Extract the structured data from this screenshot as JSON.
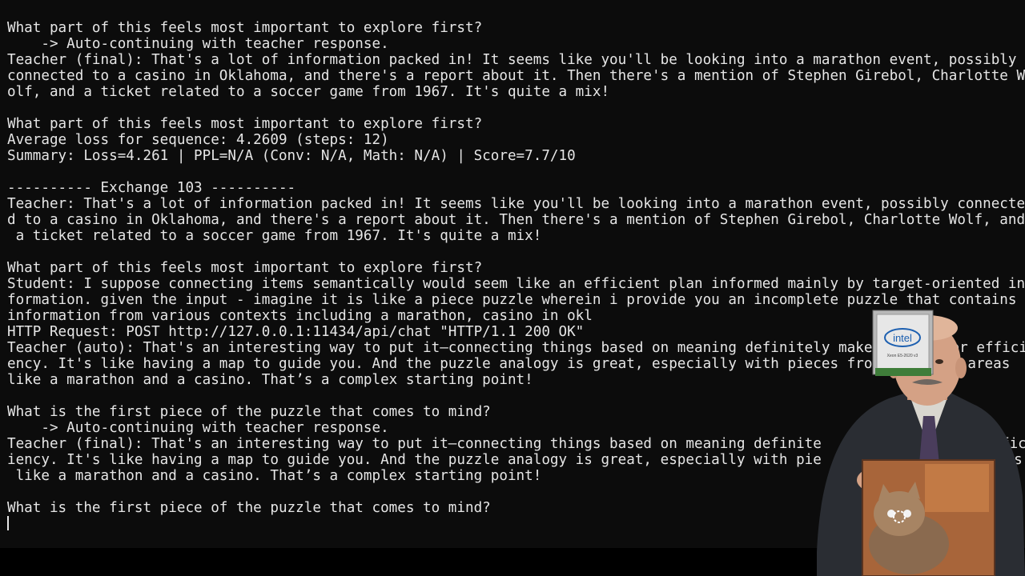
{
  "terminal": {
    "lines": [
      "What part of this feels most important to explore first?",
      "    -> Auto-continuing with teacher response.",
      "Teacher (final): That's a lot of information packed in! It seems like you'll be looking into a marathon event, possibly",
      "connected to a casino in Oklahoma, and there's a report about it. Then there's a mention of Stephen Girebol, Charlotte W",
      "olf, and a ticket related to a soccer game from 1967. It's quite a mix!",
      "",
      "What part of this feels most important to explore first?",
      "Average loss for sequence: 4.2609 (steps: 12)",
      "Summary: Loss=4.261 | PPL=N/A (Conv: N/A, Math: N/A) | Score=7.7/10",
      "",
      "---------- Exchange 103 ----------",
      "Teacher: That's a lot of information packed in! It seems like you'll be looking into a marathon event, possibly connecte",
      "d to a casino in Oklahoma, and there's a report about it. Then there's a mention of Stephen Girebol, Charlotte Wolf, and",
      " a ticket related to a soccer game from 1967. It's quite a mix!",
      "",
      "What part of this feels most important to explore first?",
      "Student: I suppose connecting items semantically would seem like an efficient plan informed mainly by target-oriented in",
      "formation. given the input - imagine it is like a piece puzzle wherein i provide you an incomplete puzzle that contains",
      "information from various contexts including a marathon, casino in okl",
      "HTTP Request: POST http://127.0.0.1:11434/api/chat \"HTTP/1.1 200 OK\"",
      "Teacher (auto): That's an interesting way to put it—connecting things based on meaning definitely make",
      "ency. It's like having a map to guide you. And the puzzle analogy is great, especially with pieces fro",
      "like a marathon and a casino. That’s a complex starting point!",
      "",
      "What is the first piece of the puzzle that comes to mind?",
      "    -> Auto-continuing with teacher response.",
      "Teacher (final): That's an interesting way to put it—connecting things based on meaning definite",
      "iency. It's like having a map to guide you. And the puzzle analogy is great, especially with pie",
      " like a marathon and a casino. That’s a complex starting point!",
      "",
      "What is the first piece of the puzzle that comes to mind?"
    ],
    "overflow_right": {
      "l20": "for effici",
      "l21": "ent areas",
      "l26": "fic",
      "l27": "eas"
    }
  },
  "overlay": {
    "chip_brand": "intel",
    "chip_model": "Xeon E5-2620 v3"
  },
  "colors": {
    "terminal_bg": "#0c0c0c",
    "terminal_fg": "#e6e6e6"
  }
}
